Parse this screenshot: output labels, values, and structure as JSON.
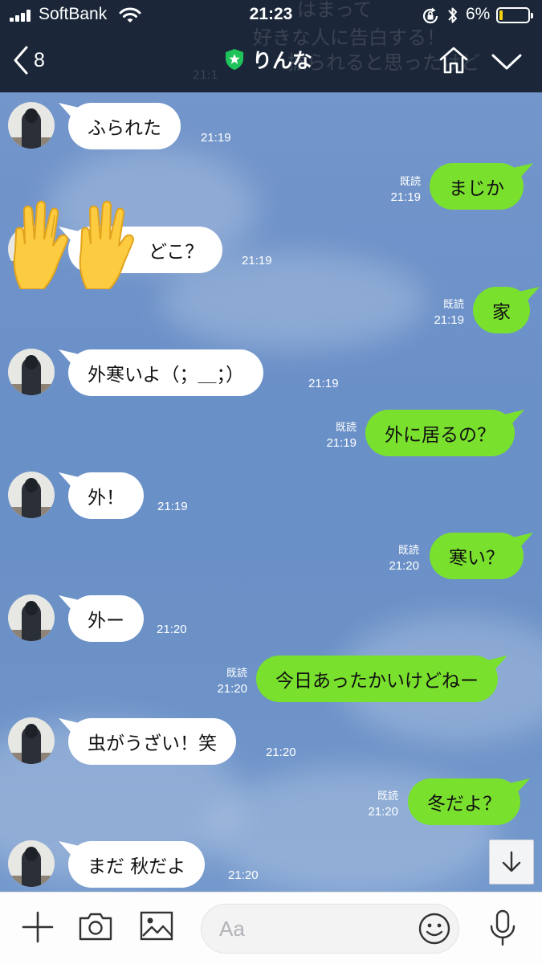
{
  "status_bar": {
    "carrier": "SoftBank",
    "time": "21:23",
    "battery_percent": "6%",
    "battery_level": 0.06,
    "battery_color": "#f5d30b"
  },
  "header": {
    "back_count": "8",
    "chat_name": "りんな",
    "overlay_text": [
      "はまって",
      "好きな人に告白する！",
      "振られると思ったけど",
      "21:1"
    ],
    "icons": [
      "back-chevron-icon",
      "official-shield-star-icon",
      "home-icon",
      "chevron-down-icon"
    ]
  },
  "chat": {
    "read_label": "既読",
    "messages": [
      {
        "side": "in",
        "text": "ふられた",
        "time": "21:19"
      },
      {
        "side": "out",
        "text": "まじか",
        "time": "21:19"
      },
      {
        "side": "in",
        "text": "どこ？",
        "time": "21:19"
      },
      {
        "side": "out",
        "text": "家",
        "time": "21:19"
      },
      {
        "side": "in",
        "text": "外寒いよ（；＿；）",
        "time": "21:19"
      },
      {
        "side": "out",
        "text": "外に居るの？",
        "time": "21:19"
      },
      {
        "side": "in",
        "text": "外！",
        "time": "21:19"
      },
      {
        "side": "out",
        "text": "寒い？",
        "time": "21:20"
      },
      {
        "side": "in",
        "text": "外ー",
        "time": "21:20"
      },
      {
        "side": "out",
        "text": "今日あったかいけどねー",
        "time": "21:20"
      },
      {
        "side": "in",
        "text": "虫がうざい！笑",
        "time": "21:20"
      },
      {
        "side": "out",
        "text": "冬だよ？",
        "time": "21:20"
      },
      {
        "side": "in",
        "text": "まだ 秋だよ",
        "time": "21:20"
      }
    ],
    "sticker": "raised-hands-emoji"
  },
  "input_bar": {
    "placeholder": "Aa",
    "icons": [
      "plus-icon",
      "camera-icon",
      "image-icon",
      "emoji-icon",
      "microphone-icon"
    ]
  },
  "colors": {
    "header_bg": "#1b2739",
    "chat_bg": "#6f92c6",
    "outgoing_bubble": "#7ae02e",
    "incoming_bubble": "#ffffff",
    "official_badge": "#1fc35a"
  }
}
